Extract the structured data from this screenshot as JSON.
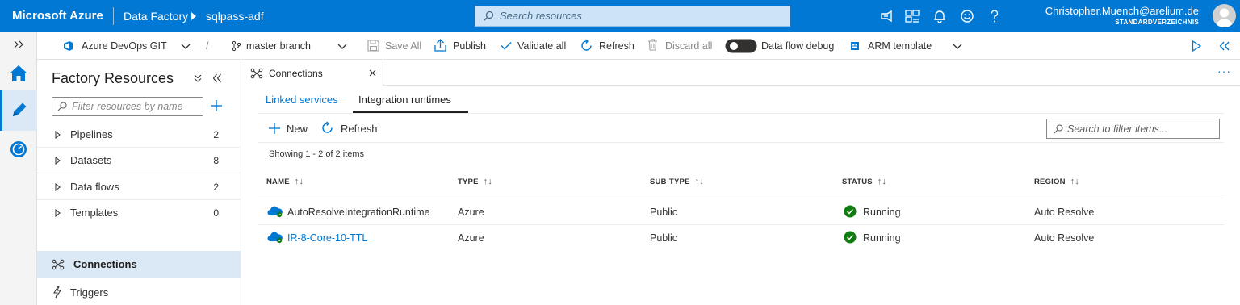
{
  "header": {
    "brand": "Microsoft Azure",
    "breadcrumb": [
      "Data Factory",
      "sqlpass-adf"
    ],
    "search_placeholder": "Search resources",
    "user_name": "Christopher.Muench@arelium.de",
    "user_directory": "STANDARDVERZEICHNIS"
  },
  "toolbar": {
    "repo": "Azure DevOps GIT",
    "branch_separator": "/",
    "branch": "master branch",
    "save_all": "Save All",
    "publish": "Publish",
    "validate_all": "Validate all",
    "refresh": "Refresh",
    "discard_all": "Discard all",
    "data_flow_debug": "Data flow debug",
    "arm_template": "ARM template"
  },
  "factory_resources": {
    "title": "Factory Resources",
    "filter_placeholder": "Filter resources by name",
    "items": [
      {
        "label": "Pipelines",
        "count": "2"
      },
      {
        "label": "Datasets",
        "count": "8"
      },
      {
        "label": "Data flows",
        "count": "2"
      },
      {
        "label": "Templates",
        "count": "0"
      }
    ],
    "connections": "Connections",
    "triggers": "Triggers"
  },
  "main": {
    "tab": "Connections",
    "subtabs": [
      "Linked services",
      "Integration runtimes"
    ],
    "active_subtab": "Integration runtimes",
    "new": "New",
    "refresh": "Refresh",
    "filter_placeholder": "Search to filter items...",
    "showing": "Showing 1 - 2 of 2 items",
    "columns": [
      "NAME",
      "TYPE",
      "SUB-TYPE",
      "STATUS",
      "REGION"
    ],
    "rows": [
      {
        "name": "AutoResolveIntegrationRuntime",
        "type": "Azure",
        "subtype": "Public",
        "status": "Running",
        "region": "Auto Resolve",
        "link": false
      },
      {
        "name": "IR-8-Core-10-TTL",
        "type": "Azure",
        "subtype": "Public",
        "status": "Running",
        "region": "Auto Resolve",
        "link": true
      }
    ]
  },
  "colors": {
    "accent": "#0078d4",
    "success": "#107c10",
    "selected_bg": "#dbe8f6"
  }
}
